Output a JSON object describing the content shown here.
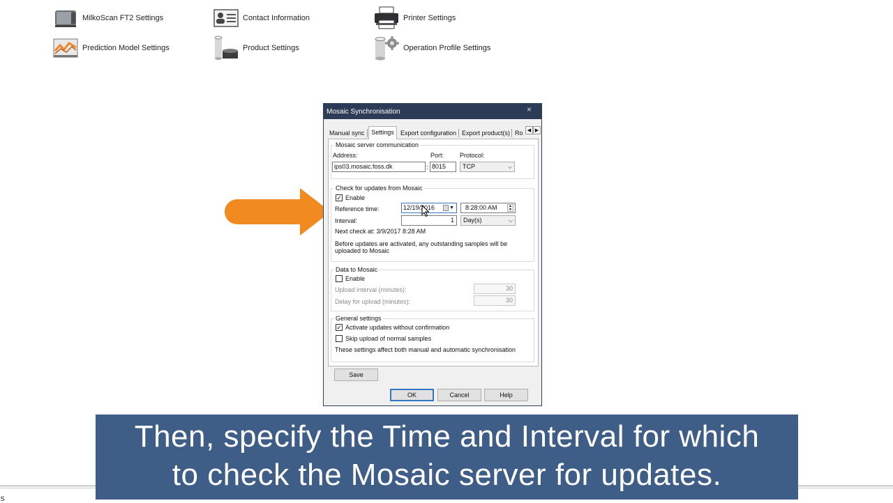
{
  "settings_icons": [
    {
      "label": "MilkoScan FT2 Settings",
      "icon": "instrument-icon"
    },
    {
      "label": "Contact Information",
      "icon": "contact-card-icon"
    },
    {
      "label": "Printer Settings",
      "icon": "printer-icon"
    },
    {
      "label": "Prediction Model Settings",
      "icon": "chart-icon"
    },
    {
      "label": "Product Settings",
      "icon": "product-cylinder-icon"
    },
    {
      "label": "Operation Profile Settings",
      "icon": "gear-cylinder-icon"
    }
  ],
  "bottom_text": "gs",
  "dialog": {
    "title": "Mosaic Synchronisation",
    "close": "×",
    "tabs": [
      "Manual sync",
      "Settings",
      "Export configuration",
      "Export product(s)",
      "Ro"
    ],
    "active_tab": "Settings",
    "server": {
      "group_title": "Mosaic server communication",
      "address_label": "Address:",
      "address_value": "ips03.mosaic.foss.dk",
      "port_label": "Port:",
      "port_value": "8015",
      "port_sep": ":",
      "protocol_label": "Protocol:",
      "protocol_value": "TCP"
    },
    "updates": {
      "group_title": "Check for updates from Mosaic",
      "enable_label": "Enable",
      "enable_checked": true,
      "reference_label": "Reference time:",
      "date_value": "12/19/2016",
      "time_value": "8:28:00 AM",
      "interval_label": "Interval:",
      "interval_value": "1",
      "interval_unit": "Day(s)",
      "next_check": "Next check at: 3/9/2017 8:28 AM",
      "note": "Before updates are activated, any outstanding samples will be uploaded to Mosaic"
    },
    "data_to_mosaic": {
      "group_title": "Data to Mosaic",
      "enable_label": "Enable",
      "enable_checked": false,
      "upload_interval_label": "Upload interval (minutes):",
      "upload_interval_value": "30",
      "delay_label": "Delay for upload (minutes):",
      "delay_value": "30"
    },
    "general": {
      "group_title": "General settings",
      "activate_label": "Activate updates without confirmation",
      "activate_checked": true,
      "skip_label": "Skip upload of normal samples",
      "skip_checked": false,
      "note": "These settings affect both manual and automatic synchronisation"
    },
    "save_label": "Save",
    "ok_label": "OK",
    "cancel_label": "Cancel",
    "help_label": "Help"
  },
  "caption": {
    "line1": "Then, specify the Time and Interval for which",
    "line2": "to check the Mosaic server for updates."
  },
  "colors": {
    "caption_bg": "#3e5d87",
    "arrow": "#f28a22",
    "titlebar": "#2c3b56"
  }
}
